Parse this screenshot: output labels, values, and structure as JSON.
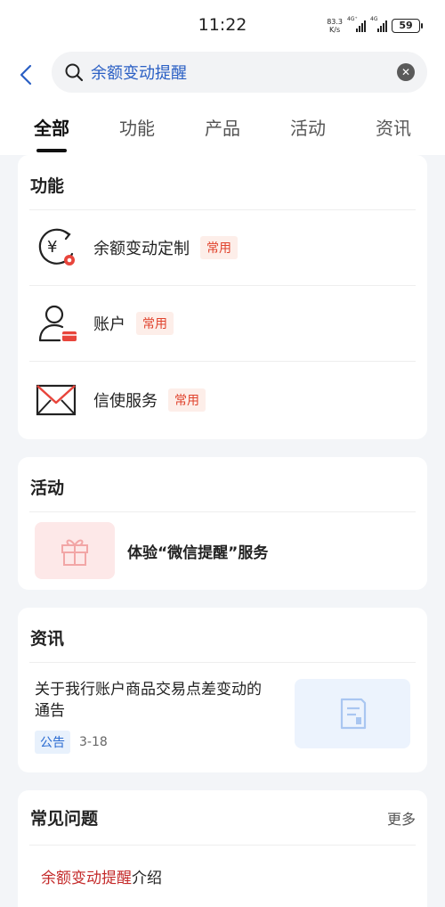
{
  "status": {
    "time": "11:22",
    "netspeed_value": "83.3",
    "netspeed_unit": "K/s",
    "sig1_label": "4G⁺",
    "sig2_label": "4G",
    "battery": "59"
  },
  "search": {
    "query": "余额变动提醒"
  },
  "tabs": [
    "全部",
    "功能",
    "产品",
    "活动",
    "资讯"
  ],
  "functions": {
    "title": "功能",
    "items": [
      {
        "label": "余额变动定制",
        "badge": "常用",
        "icon": "yen-refresh-icon"
      },
      {
        "label": "账户",
        "badge": "常用",
        "icon": "user-account-icon"
      },
      {
        "label": "信使服务",
        "badge": "常用",
        "icon": "envelope-icon"
      }
    ]
  },
  "activity": {
    "title": "活动",
    "item": {
      "label": "体验“微信提醒”服务",
      "icon": "gift-icon"
    }
  },
  "news": {
    "title": "资讯",
    "item": {
      "title": "关于我行账户商品交易点差变动的通告",
      "tag": "公告",
      "date": "3-18",
      "icon": "document-icon"
    }
  },
  "faq": {
    "title": "常见问题",
    "more": "更多",
    "item_highlight": "余额变动提醒",
    "item_rest": "介绍"
  },
  "colors": {
    "accent_blue": "#2a5fc4",
    "badge_red": "#e0432d",
    "highlight_red": "#c42a2a"
  }
}
